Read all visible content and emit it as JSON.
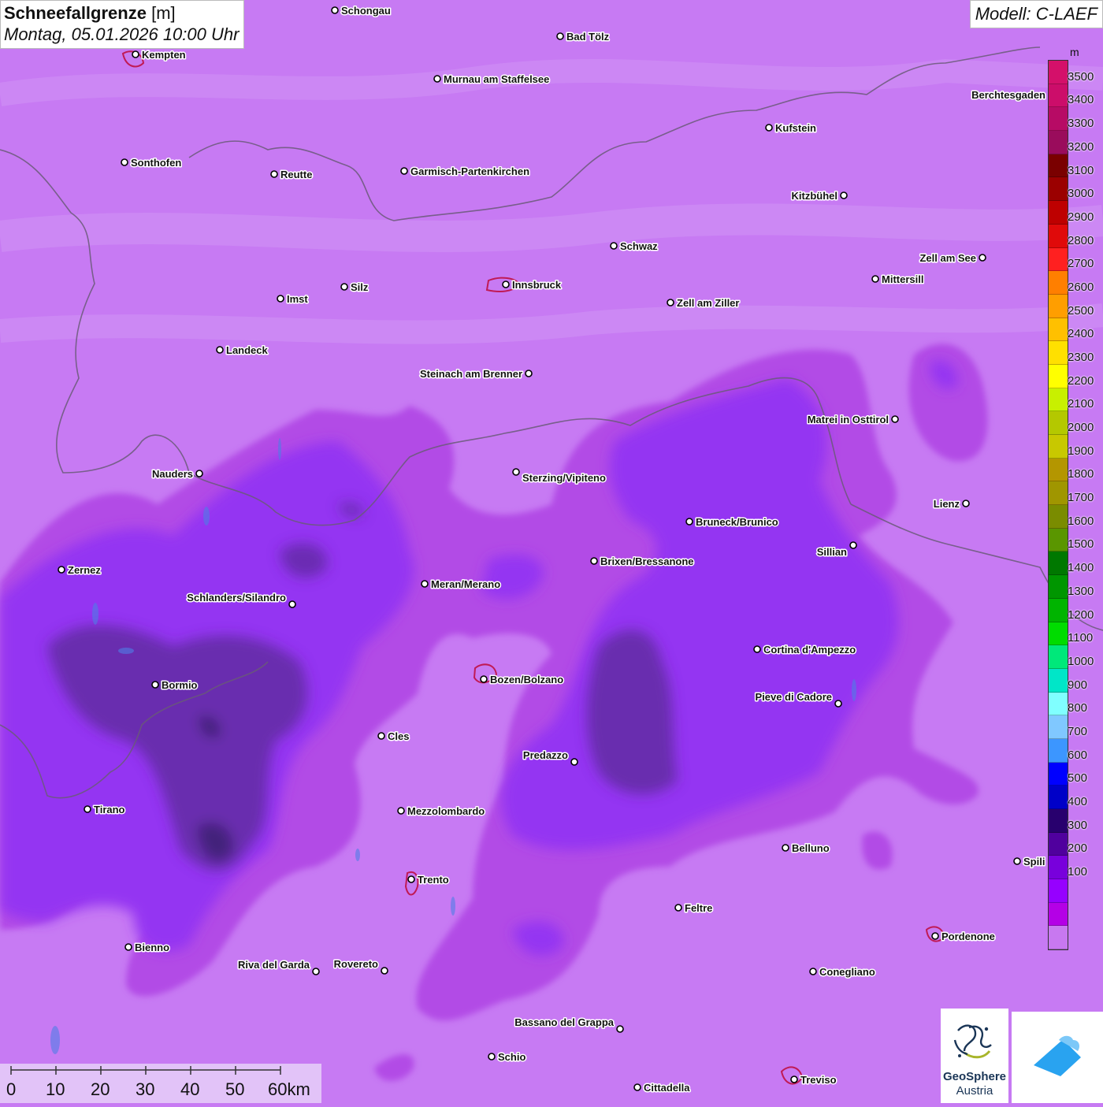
{
  "title": {
    "variable": "Schneefallgrenze",
    "unit": "[m]",
    "datetime": "Montag, 05.01.2026 10:00 Uhr"
  },
  "model": "Modell: C-LAEF",
  "legend": {
    "unit": "m",
    "ticks": [
      "3500",
      "3400",
      "3300",
      "3200",
      "3100",
      "3000",
      "2900",
      "2800",
      "2700",
      "2600",
      "2500",
      "2400",
      "2300",
      "2200",
      "2100",
      "2000",
      "1900",
      "1800",
      "1700",
      "1600",
      "1500",
      "1400",
      "1300",
      "1200",
      "1100",
      "1000",
      "900",
      "800",
      "700",
      "600",
      "500",
      "400",
      "300",
      "200",
      "100"
    ],
    "colors": [
      "#d4106a",
      "#cc0d6a",
      "#b70b65",
      "#9a0c5c",
      "#7a0000",
      "#9b0000",
      "#be0000",
      "#e00a0a",
      "#ff2020",
      "#ff7f00",
      "#ff9e00",
      "#ffc000",
      "#ffe000",
      "#ffff00",
      "#c8f000",
      "#b4c800",
      "#c8c800",
      "#b49600",
      "#a09600",
      "#7a8c00",
      "#5a9600",
      "#007800",
      "#009600",
      "#00b400",
      "#00dc00",
      "#00e87a",
      "#00e6c8",
      "#80ffff",
      "#80c8ff",
      "#3c96ff",
      "#0000ff",
      "#0000c8",
      "#28006e",
      "#50009e",
      "#7800dc",
      "#9600ff",
      "#b400e6",
      "#c878f0"
    ]
  },
  "cities": [
    {
      "name": "Schongau",
      "id": "schongau"
    },
    {
      "name": "Bad Tölz",
      "id": "bad-toelz"
    },
    {
      "name": "Kempten",
      "id": "kempten"
    },
    {
      "name": "Murnau am Staffelsee",
      "id": "murnau"
    },
    {
      "name": "Berchtesgaden",
      "id": "berchtesgaden"
    },
    {
      "name": "Kufstein",
      "id": "kufstein"
    },
    {
      "name": "Sonthofen",
      "id": "sonthofen"
    },
    {
      "name": "Reutte",
      "id": "reutte"
    },
    {
      "name": "Garmisch-Partenkirchen",
      "id": "garmisch"
    },
    {
      "name": "Kitzbühel",
      "id": "kitzbuehel"
    },
    {
      "name": "Schwaz",
      "id": "schwaz"
    },
    {
      "name": "Zell am See",
      "id": "zell-am-see"
    },
    {
      "name": "Mittersill",
      "id": "mittersill"
    },
    {
      "name": "Innsbruck",
      "id": "innsbruck"
    },
    {
      "name": "Imst",
      "id": "imst"
    },
    {
      "name": "Silz",
      "id": "silz"
    },
    {
      "name": "Zell am Ziller",
      "id": "zell-am-ziller"
    },
    {
      "name": "Landeck",
      "id": "landeck"
    },
    {
      "name": "Steinach am Brenner",
      "id": "steinach"
    },
    {
      "name": "Matrei in Osttirol",
      "id": "matrei"
    },
    {
      "name": "Nauders",
      "id": "nauders"
    },
    {
      "name": "Sterzing/Vipiteno",
      "id": "sterzing"
    },
    {
      "name": "Lienz",
      "id": "lienz"
    },
    {
      "name": "Bruneck/Brunico",
      "id": "bruneck"
    },
    {
      "name": "Sillian",
      "id": "sillian"
    },
    {
      "name": "Zernez",
      "id": "zernez"
    },
    {
      "name": "Brixen/Bressanone",
      "id": "brixen"
    },
    {
      "name": "Meran/Merano",
      "id": "meran"
    },
    {
      "name": "Schlanders/Silandro",
      "id": "schlanders"
    },
    {
      "name": "Cortina d'Ampezzo",
      "id": "cortina"
    },
    {
      "name": "Bozen/Bolzano",
      "id": "bozen"
    },
    {
      "name": "Bormio",
      "id": "bormio"
    },
    {
      "name": "Pieve di Cadore",
      "id": "pieve"
    },
    {
      "name": "Cles",
      "id": "cles"
    },
    {
      "name": "Predazzo",
      "id": "predazzo"
    },
    {
      "name": "Tirano",
      "id": "tirano"
    },
    {
      "name": "Mezzolombardo",
      "id": "mezzolombardo"
    },
    {
      "name": "Belluno",
      "id": "belluno"
    },
    {
      "name": "Spili",
      "id": "spili"
    },
    {
      "name": "Trento",
      "id": "trento"
    },
    {
      "name": "Feltre",
      "id": "feltre"
    },
    {
      "name": "Pordenone",
      "id": "pordenone"
    },
    {
      "name": "Bienno",
      "id": "bienno"
    },
    {
      "name": "Riva del Garda",
      "id": "riva"
    },
    {
      "name": "Rovereto",
      "id": "rovereto"
    },
    {
      "name": "Conegliano",
      "id": "conegliano"
    },
    {
      "name": "Bassano del Grappa",
      "id": "bassano"
    },
    {
      "name": "Schio",
      "id": "schio"
    },
    {
      "name": "Treviso",
      "id": "treviso"
    },
    {
      "name": "Cittadella",
      "id": "cittadella"
    }
  ],
  "scalebar": {
    "labels": [
      "0",
      "10",
      "20",
      "30",
      "40",
      "50",
      "60km"
    ]
  },
  "logos": {
    "geosphere_line1": "GeoSphere",
    "geosphere_line2": "Austria"
  }
}
